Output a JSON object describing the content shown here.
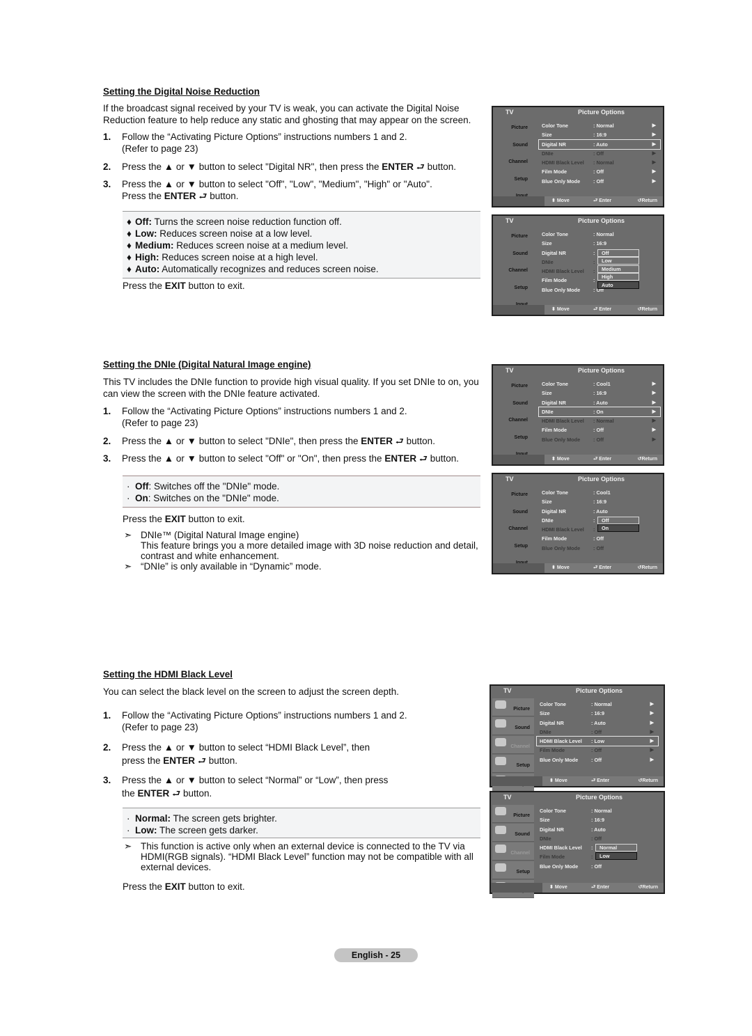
{
  "sections": {
    "dnr": {
      "heading": "Setting the Digital Noise Reduction",
      "intro": "If the broadcast signal received by your TV is weak, you can activate the Digital Noise Reduction feature to help reduce any static and ghosting that may appear on the screen.",
      "steps": [
        {
          "num": "1.",
          "line1": "Follow the “Activating Picture Options” instructions numbers 1 and 2.",
          "line2": "(Refer to page 23)"
        },
        {
          "num": "2.",
          "line1": "Press the ▲ or ▼ button to select \"Digital NR\", then press the ",
          "bold": "ENTER",
          "after": " button."
        },
        {
          "num": "3.",
          "line1": "Press the ▲ or ▼ button to select \"Off\", \"Low\", \"Medium\", \"High\" or \"Auto\".",
          "line2a": "Press the ",
          "bold": "ENTER",
          "after": " button."
        }
      ],
      "options": [
        {
          "term": "Off:",
          "desc": " Turns the screen noise reduction function off."
        },
        {
          "term": "Low:",
          "desc": " Reduces screen noise at a low level."
        },
        {
          "term": "Medium:",
          "desc": " Reduces screen noise at a medium level."
        },
        {
          "term": "High:",
          "desc": " Reduces screen noise at a high level."
        },
        {
          "term": "Auto:",
          "desc": " Automatically recognizes and reduces screen noise."
        }
      ],
      "exit_pre": "Press the ",
      "exit_bold": "EXIT",
      "exit_post": " button to exit."
    },
    "dnie": {
      "heading": "Setting the DNIe (Digital Natural Image engine)",
      "intro": "This TV includes the DNIe function to provide high visual quality. If you set DNIe to on, you can view the screen with the DNIe feature activated.",
      "steps": [
        {
          "num": "1.",
          "line1": "Follow the “Activating Picture Options” instructions numbers 1 and 2.",
          "line2": "(Refer to page 23)"
        },
        {
          "num": "2.",
          "line1": "Press the ▲ or ▼ button to select \"DNIe\", then press the ",
          "bold": "ENTER",
          "after": " button."
        },
        {
          "num": "3.",
          "line1": "Press the ▲ or ▼ button to select \"Off\" or \"On\", then press the ",
          "bold": "ENTER",
          "after": " button."
        }
      ],
      "options": [
        {
          "term": "Off",
          "desc": ": Switches off the \"DNIe\" mode."
        },
        {
          "term": "On",
          "desc": ": Switches on the \"DNIe\" mode."
        }
      ],
      "exit_pre": "Press the ",
      "exit_bold": "EXIT",
      "exit_post": " button to exit.",
      "notes": [
        "DNIe™ (Digital Natural Image engine)\nThis feature brings you a more detailed image with 3D noise reduction and detail, contrast and white enhancement.",
        "“DNIe” is only available in “Dynamic” mode."
      ],
      "note1_title": "DNIe™ (Digital Natural Image engine)",
      "note1_body": "This feature brings you a more detailed image with 3D noise reduction and detail, contrast and white enhancement.",
      "note2": "“DNIe” is only available in “Dynamic” mode."
    },
    "hdmi": {
      "heading": "Setting the HDMI Black Level",
      "intro": "You can select the black level on the screen to adjust the screen depth.",
      "steps": [
        {
          "num": "1.",
          "line1": "Follow the “Activating Picture Options” instructions numbers 1 and 2.",
          "line2": "(Refer to page 23)"
        },
        {
          "num": "2.",
          "line1": "Press the ▲ or ▼ button to select “HDMI Black Level”, then",
          "line2a": "press the ",
          "bold": "ENTER",
          "after": " button."
        },
        {
          "num": "3.",
          "line1": "Press the ▲ or ▼ button to select “Normal” or “Low”, then press",
          "line2a": "the ",
          "bold": "ENTER",
          "after": " button."
        }
      ],
      "options": [
        {
          "term": "Normal:",
          "desc": " The screen gets brighter."
        },
        {
          "term": "Low:",
          "desc": " The screen gets darker."
        }
      ],
      "note": "This function is active only when an external device is connected to the TV via HDMI(RGB signals). “HDMI Black Level” function may not be compatible with all external devices.",
      "exit_pre": "Press the ",
      "exit_bold": "EXIT",
      "exit_post": " button to exit."
    }
  },
  "icons": {
    "enter": "⮐",
    "note_arrow": "➣",
    "bullet_diamond": "•"
  },
  "osd": {
    "tv_label": "TV",
    "title": "Picture Options",
    "sidebar": [
      "Picture",
      "Sound",
      "Channel",
      "Setup",
      "Input"
    ],
    "labels": [
      "Color Tone",
      "Size",
      "Digital NR",
      "DNIe",
      "HDMI Black Level",
      "Film Mode",
      "Blue Only Mode"
    ],
    "footer": {
      "move": "Move",
      "enter": "Enter",
      "return": "Return"
    },
    "screens": [
      {
        "values": [
          ": Normal",
          ": 16:9",
          ": Auto",
          ": Off",
          ": Normal",
          ": Off",
          ": Off"
        ],
        "selected": 2
      },
      {
        "values": [
          ": Normal",
          ": 16:9",
          ":",
          ":",
          ":",
          ":",
          ": Off"
        ],
        "dropdown": [
          "Off",
          "Low",
          "Medium",
          "High",
          "Auto"
        ],
        "dropdown_current": "Auto"
      },
      {
        "values": [
          ": Cool1",
          ": 16:9",
          ": Auto",
          ": On",
          ": Normal",
          ": Off",
          ": Off"
        ],
        "selected": 3
      },
      {
        "values": [
          ": Cool1",
          ": 16:9",
          ": Auto",
          ":",
          ":",
          ": Off",
          ": Off"
        ],
        "dropdown": [
          "Off",
          "On"
        ],
        "dropdown_current": "On"
      },
      {
        "values": [
          ": Normal",
          ": 16:9",
          ": Auto",
          ": Off",
          ": Low",
          ": Off",
          ": Off"
        ],
        "selected": 4
      },
      {
        "values": [
          ": Normal",
          ": 16:9",
          ": Auto",
          ": Off",
          ":",
          ":",
          ": Off"
        ],
        "dropdown": [
          "Normal",
          "Low"
        ],
        "dropdown_current": "Low"
      }
    ]
  },
  "footer": {
    "page_label": "English - 25"
  }
}
